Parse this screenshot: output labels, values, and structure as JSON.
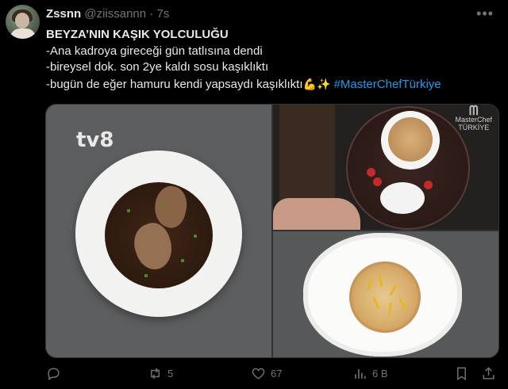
{
  "tweet": {
    "display_name": "Zssnn",
    "handle": "@ziissannn",
    "separator": "·",
    "time": "7s",
    "lines": [
      "BEYZA’NIN KAŞIK YOLCULUĞU",
      "-Ana kadroya gireceği gün tatlısına dendi",
      "-bireysel dok. son 2ye kaldı sosu kaşıklıktı",
      "-bugün de eğer hamuru kendi yapsaydı kaşıklıktı"
    ],
    "emojis": "💪✨",
    "hashtag": "#MasterChefTürkiye"
  },
  "media": {
    "left_logo": "tv8",
    "top_right_logo_line1": "MasterChef",
    "top_right_logo_line2": "TÜRKİYE"
  },
  "actions": {
    "reply_icon": "reply-icon",
    "retweet_icon": "retweet-icon",
    "retweet_count": "5",
    "like_icon": "heart-icon",
    "like_count": "67",
    "views_icon": "views-icon",
    "views_count": "6 B",
    "bookmark_icon": "bookmark-icon",
    "share_icon": "share-icon"
  },
  "colors": {
    "background": "#000000",
    "text": "#e7e9ea",
    "muted": "#71767b",
    "link": "#1d9bf0"
  }
}
